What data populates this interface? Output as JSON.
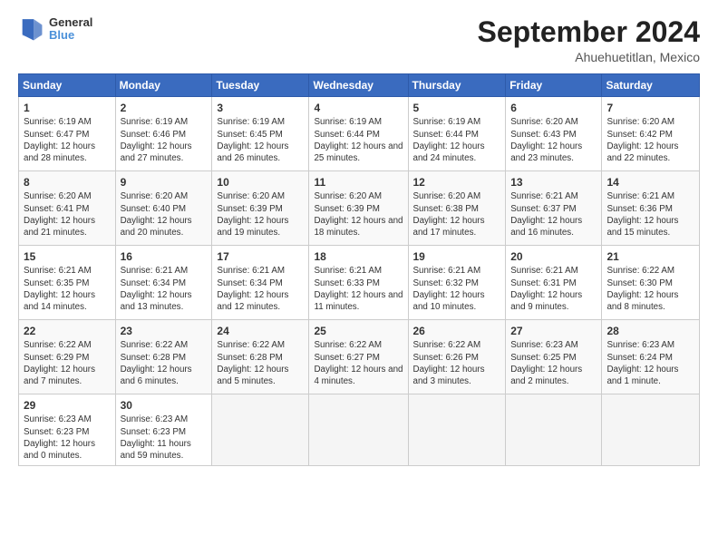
{
  "logo": {
    "line1": "General",
    "line2": "Blue"
  },
  "title": "September 2024",
  "subtitle": "Ahuehuetitlan, Mexico",
  "headers": [
    "Sunday",
    "Monday",
    "Tuesday",
    "Wednesday",
    "Thursday",
    "Friday",
    "Saturday"
  ],
  "weeks": [
    [
      {
        "day": "1",
        "rise": "6:19 AM",
        "set": "6:47 PM",
        "daylight": "12 hours and 28 minutes."
      },
      {
        "day": "2",
        "rise": "6:19 AM",
        "set": "6:46 PM",
        "daylight": "12 hours and 27 minutes."
      },
      {
        "day": "3",
        "rise": "6:19 AM",
        "set": "6:45 PM",
        "daylight": "12 hours and 26 minutes."
      },
      {
        "day": "4",
        "rise": "6:19 AM",
        "set": "6:44 PM",
        "daylight": "12 hours and 25 minutes."
      },
      {
        "day": "5",
        "rise": "6:19 AM",
        "set": "6:44 PM",
        "daylight": "12 hours and 24 minutes."
      },
      {
        "day": "6",
        "rise": "6:20 AM",
        "set": "6:43 PM",
        "daylight": "12 hours and 23 minutes."
      },
      {
        "day": "7",
        "rise": "6:20 AM",
        "set": "6:42 PM",
        "daylight": "12 hours and 22 minutes."
      }
    ],
    [
      {
        "day": "8",
        "rise": "6:20 AM",
        "set": "6:41 PM",
        "daylight": "12 hours and 21 minutes."
      },
      {
        "day": "9",
        "rise": "6:20 AM",
        "set": "6:40 PM",
        "daylight": "12 hours and 20 minutes."
      },
      {
        "day": "10",
        "rise": "6:20 AM",
        "set": "6:39 PM",
        "daylight": "12 hours and 19 minutes."
      },
      {
        "day": "11",
        "rise": "6:20 AM",
        "set": "6:39 PM",
        "daylight": "12 hours and 18 minutes."
      },
      {
        "day": "12",
        "rise": "6:20 AM",
        "set": "6:38 PM",
        "daylight": "12 hours and 17 minutes."
      },
      {
        "day": "13",
        "rise": "6:21 AM",
        "set": "6:37 PM",
        "daylight": "12 hours and 16 minutes."
      },
      {
        "day": "14",
        "rise": "6:21 AM",
        "set": "6:36 PM",
        "daylight": "12 hours and 15 minutes."
      }
    ],
    [
      {
        "day": "15",
        "rise": "6:21 AM",
        "set": "6:35 PM",
        "daylight": "12 hours and 14 minutes."
      },
      {
        "day": "16",
        "rise": "6:21 AM",
        "set": "6:34 PM",
        "daylight": "12 hours and 13 minutes."
      },
      {
        "day": "17",
        "rise": "6:21 AM",
        "set": "6:34 PM",
        "daylight": "12 hours and 12 minutes."
      },
      {
        "day": "18",
        "rise": "6:21 AM",
        "set": "6:33 PM",
        "daylight": "12 hours and 11 minutes."
      },
      {
        "day": "19",
        "rise": "6:21 AM",
        "set": "6:32 PM",
        "daylight": "12 hours and 10 minutes."
      },
      {
        "day": "20",
        "rise": "6:21 AM",
        "set": "6:31 PM",
        "daylight": "12 hours and 9 minutes."
      },
      {
        "day": "21",
        "rise": "6:22 AM",
        "set": "6:30 PM",
        "daylight": "12 hours and 8 minutes."
      }
    ],
    [
      {
        "day": "22",
        "rise": "6:22 AM",
        "set": "6:29 PM",
        "daylight": "12 hours and 7 minutes."
      },
      {
        "day": "23",
        "rise": "6:22 AM",
        "set": "6:28 PM",
        "daylight": "12 hours and 6 minutes."
      },
      {
        "day": "24",
        "rise": "6:22 AM",
        "set": "6:28 PM",
        "daylight": "12 hours and 5 minutes."
      },
      {
        "day": "25",
        "rise": "6:22 AM",
        "set": "6:27 PM",
        "daylight": "12 hours and 4 minutes."
      },
      {
        "day": "26",
        "rise": "6:22 AM",
        "set": "6:26 PM",
        "daylight": "12 hours and 3 minutes."
      },
      {
        "day": "27",
        "rise": "6:23 AM",
        "set": "6:25 PM",
        "daylight": "12 hours and 2 minutes."
      },
      {
        "day": "28",
        "rise": "6:23 AM",
        "set": "6:24 PM",
        "daylight": "12 hours and 1 minute."
      }
    ],
    [
      {
        "day": "29",
        "rise": "6:23 AM",
        "set": "6:23 PM",
        "daylight": "12 hours and 0 minutes."
      },
      {
        "day": "30",
        "rise": "6:23 AM",
        "set": "6:23 PM",
        "daylight": "11 hours and 59 minutes."
      },
      null,
      null,
      null,
      null,
      null
    ]
  ]
}
